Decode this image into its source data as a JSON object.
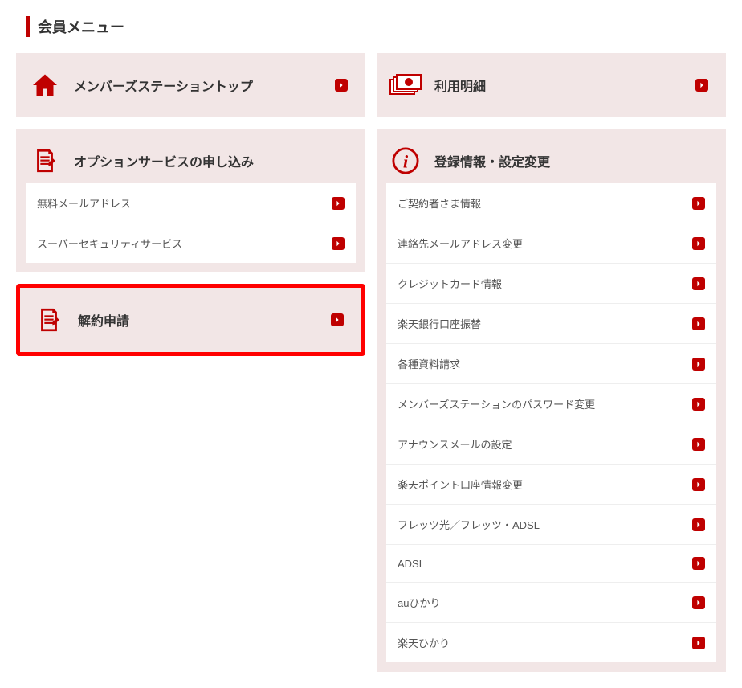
{
  "pageTitle": "会員メニュー",
  "left": {
    "top": {
      "title": "メンバーズステーショントップ"
    },
    "options": {
      "title": "オプションサービスの申し込み",
      "items": [
        {
          "label": "無料メールアドレス"
        },
        {
          "label": "スーパーセキュリティサービス"
        }
      ]
    },
    "cancel": {
      "title": "解約申請"
    }
  },
  "right": {
    "usage": {
      "title": "利用明細"
    },
    "settings": {
      "title": "登録情報・設定変更",
      "items": [
        {
          "label": "ご契約者さま情報"
        },
        {
          "label": "連絡先メールアドレス変更"
        },
        {
          "label": "クレジットカード情報"
        },
        {
          "label": "楽天銀行口座振替"
        },
        {
          "label": "各種資料請求"
        },
        {
          "label": "メンバーズステーションのパスワード変更"
        },
        {
          "label": "アナウンスメールの設定"
        },
        {
          "label": "楽天ポイント口座情報変更"
        },
        {
          "label": "フレッツ光／フレッツ・ADSL"
        },
        {
          "label": "ADSL"
        },
        {
          "label": "auひかり"
        },
        {
          "label": "楽天ひかり"
        }
      ]
    }
  }
}
